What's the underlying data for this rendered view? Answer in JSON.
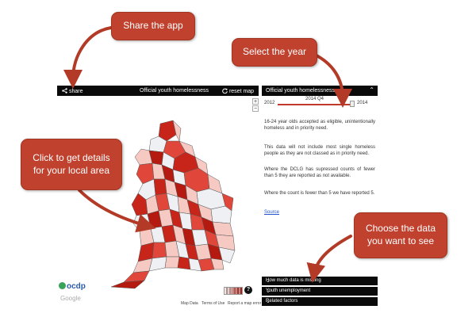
{
  "callouts": {
    "share": "Share the app",
    "year": "Select the year",
    "details": "Click to get details for your local area",
    "data": "Choose the data you want to see"
  },
  "map_bar": {
    "share_label": "share",
    "title": "Official youth homelessness",
    "reset_label": "reset map"
  },
  "panel": {
    "title": "Official youth homelessness",
    "slider": {
      "start": "2012",
      "current": "2014 Q4",
      "end": "2014",
      "value": 1.0
    },
    "paragraphs": [
      "16-24 year olds accepted as eligible, unintentionally homeless and in priority need.",
      "This data will not include most single homeless people as they are not classed as in priority need.",
      "Where the DCLG has supressed counts of fewer than 5 they are reported as not available.",
      "Where the count is fewer than 5 we have reported 5."
    ],
    "source_link": "Source"
  },
  "dropdowns": [
    "How much data is missing",
    "Youth unemployment",
    "Related factors"
  ],
  "brand": {
    "logo_text": "ocdp",
    "google_text": "Google"
  },
  "footer": {
    "map_data": "Map Data",
    "terms": "Terms of Use",
    "report": "Report a map error"
  },
  "icons": {
    "share": "share-icon",
    "reset": "refresh-icon",
    "chevron": "chevron-down-icon",
    "help": "question-icon"
  },
  "colors": {
    "accent": "#c0412e",
    "bar": "#0a0a0a",
    "region_dark": "#b51a10",
    "region_mid": "#e0473a",
    "region_light": "#f6c9c3",
    "region_blank": "#eef0f3"
  }
}
